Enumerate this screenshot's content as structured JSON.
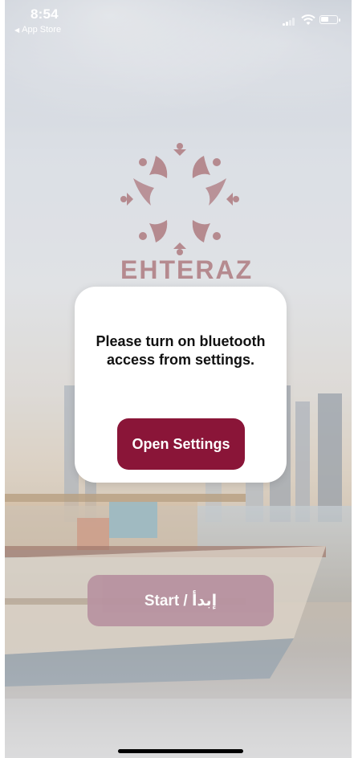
{
  "status_bar": {
    "time": "8:54",
    "back_app_label": "App Store"
  },
  "brand": {
    "name": "EHTERAZ",
    "logo_color": "#b58a8f"
  },
  "dialog": {
    "message": "Please turn on bluetooth access from settings.",
    "button_label": "Open Settings",
    "button_color": "#8a1538"
  },
  "start_button": {
    "label": "Start / إبدأ"
  }
}
